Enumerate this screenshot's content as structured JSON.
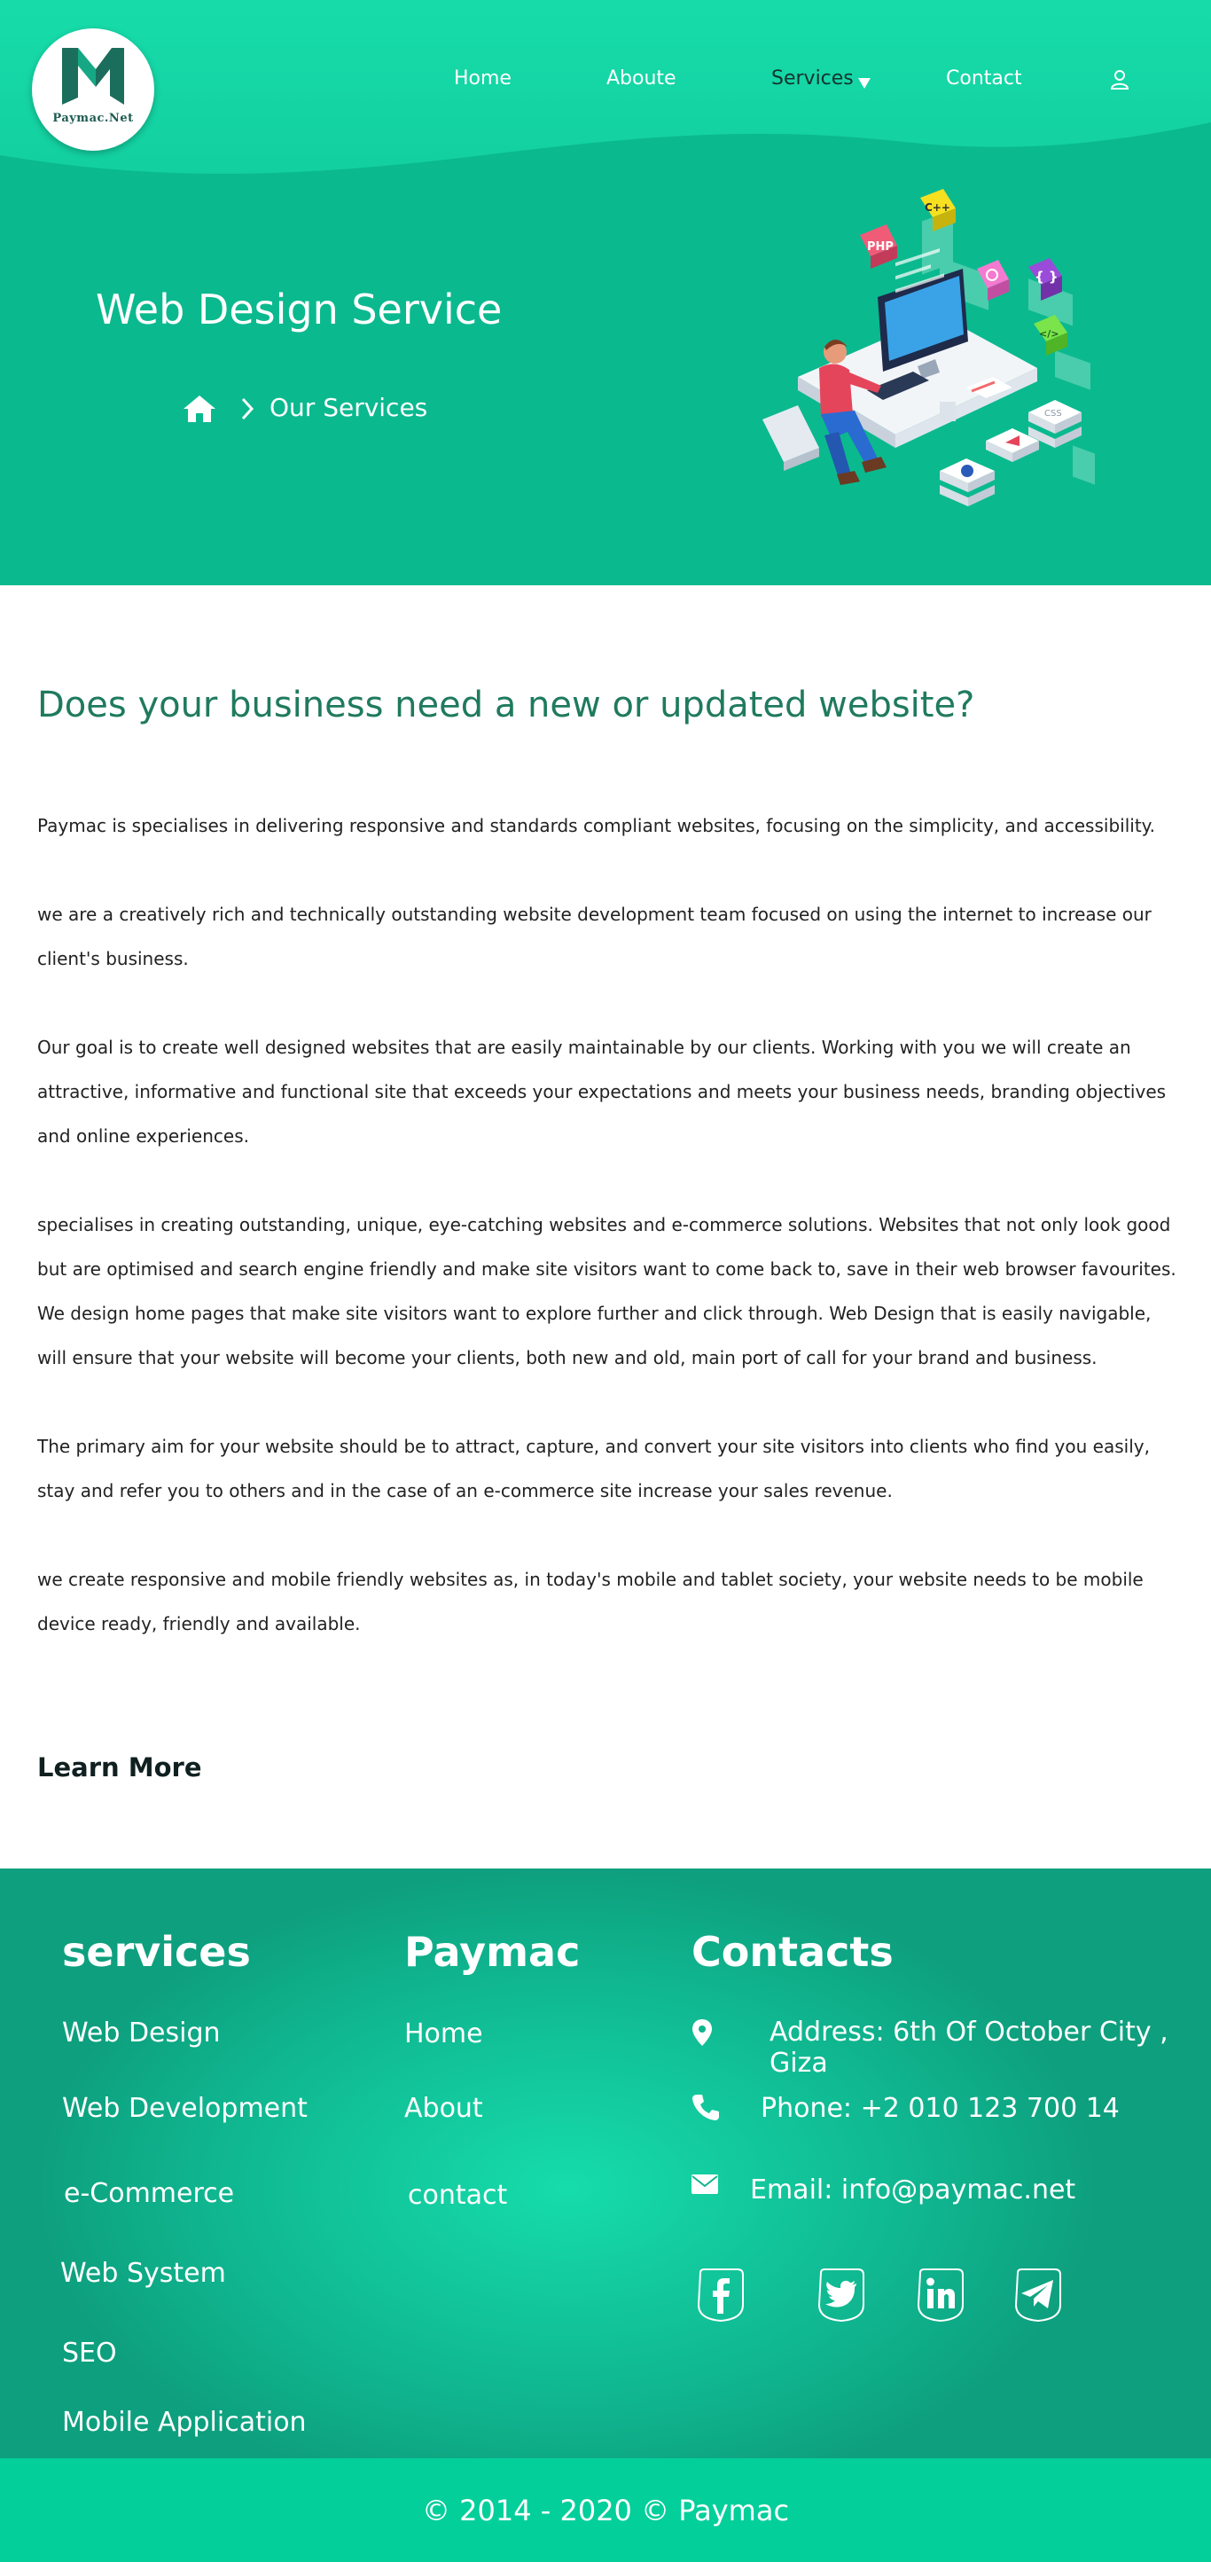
{
  "brand": {
    "logo_text": "Paymac.Net"
  },
  "nav": {
    "home": "Home",
    "about": "Aboute",
    "services": "Services",
    "contact": "Contact"
  },
  "hero": {
    "title": "Web Design Service",
    "breadcrumb_current": "Our Services"
  },
  "content": {
    "heading": "Does your business need a new or updated website?",
    "paragraphs": [
      "Paymac is specialises in delivering responsive and standards compliant websites, focusing on the simplicity, and accessibility.",
      "we are a creatively rich and technically outstanding website development team focused on using the internet to increase our client's business.",
      "Our goal is to create well designed websites that are easily maintainable by our clients. Working with you we will create an attractive, informative and functional site that exceeds your expectations and meets your business needs, branding objectives and online experiences.",
      "specialises in creating outstanding, unique, eye-catching websites and e-commerce solutions. Websites that not only look good but are optimised and search engine friendly and make site visitors want to come back to, save in their web browser favourites. We design home pages that make site visitors want to explore further and click through. Web Design that is easily navigable, will ensure that your website will become your clients, both new and old, main port of call for your brand and business.",
      "The primary aim for your website should be to attract, capture, and convert your site visitors into clients who find you easily, stay and refer you to others and in the case of an e-commerce site increase your sales revenue.",
      "we create responsive and mobile friendly websites as, in today's mobile and tablet society, your website needs to be mobile device ready, friendly and available."
    ],
    "learn_more": "Learn More"
  },
  "footer": {
    "services_heading": "services",
    "services": [
      "Web Design",
      "Web Development",
      "e-Commerce",
      "Web System",
      "SEO",
      "Mobile Application"
    ],
    "paymac_heading": "Paymac",
    "paymac_links": [
      "Home",
      "About",
      "contact"
    ],
    "contacts_heading": "Contacts",
    "address": "Address: 6th Of October City , Giza",
    "phone": "Phone: +2 010 123 700 14",
    "email": "Email: info@paymac.net",
    "social": [
      "facebook-icon",
      "twitter-icon",
      "linkedin-icon",
      "telegram-icon"
    ],
    "copyright": "© 2014 - 2020 © Paymac"
  },
  "colors": {
    "primary": "#0bb98f",
    "heading": "#1f7a5e",
    "bottom_bar": "#03cf9b"
  }
}
